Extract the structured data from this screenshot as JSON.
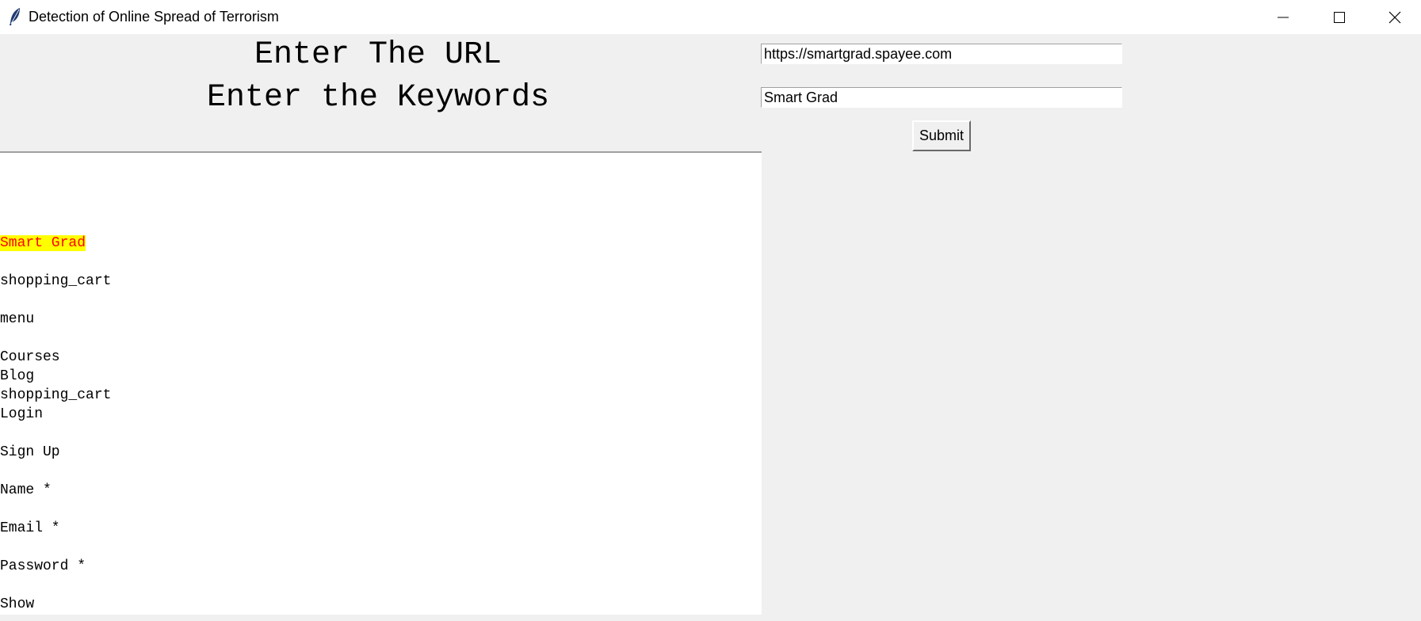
{
  "window": {
    "title": "Detection of Online Spread of Terrorism",
    "icon": "feather-icon",
    "controls": [
      "minimize-icon",
      "maximize-icon",
      "close-icon"
    ]
  },
  "form": {
    "url_label": "Enter The URL",
    "keywords_label": "Enter the Keywords",
    "url_value": "https://smartgrad.spayee.com",
    "keywords_value": "Smart Grad",
    "submit_label": "Submit"
  },
  "output": {
    "highlight_colors": {
      "background": "#ffff00",
      "text": "#ff0000"
    },
    "lines": [
      "Smart Grad",
      "",
      "shopping_cart",
      "",
      "menu",
      "",
      "Courses",
      "Blog",
      "shopping_cart",
      "Login",
      "",
      "Sign Up",
      "",
      "Name *",
      "",
      "Email *",
      "",
      "Password *",
      "",
      "Show"
    ]
  }
}
